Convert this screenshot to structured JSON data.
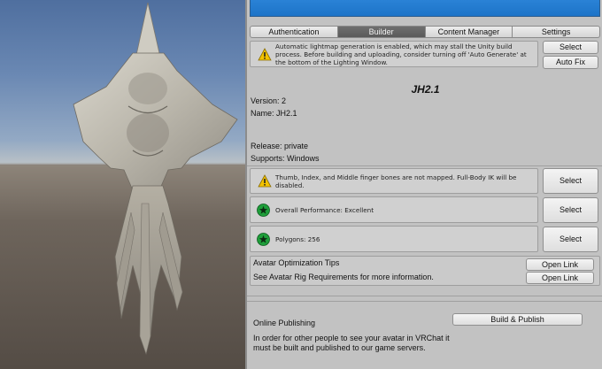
{
  "tabs": [
    {
      "label": "Authentication",
      "active": false
    },
    {
      "label": "Builder",
      "active": true
    },
    {
      "label": "Content Manager",
      "active": false
    },
    {
      "label": "Settings",
      "active": false
    }
  ],
  "lightmap_warning": {
    "icon": "warning-icon",
    "text": "Automatic lightmap generation is enabled, which may stall the Unity build process. Before building and uploading, consider turning off 'Auto Generate' at the bottom of the Lighting Window.",
    "select_label": "Select",
    "autofix_label": "Auto Fix"
  },
  "avatar": {
    "name_title": "JH2.1",
    "version_line": "Version: 2",
    "name_line": "Name: JH2.1",
    "release_line": "Release: private",
    "supports_line": "Supports: Windows"
  },
  "checks": [
    {
      "icon": "warning-icon",
      "text": "Thumb, Index, and Middle finger bones are not mapped. Full-Body IK will be disabled.",
      "button": "Select"
    },
    {
      "icon": "star-check-icon",
      "text": "Overall Performance: Excellent",
      "button": "Select"
    },
    {
      "icon": "star-check-icon",
      "text": "Polygons: 256",
      "button": "Select"
    }
  ],
  "tips": {
    "title": "Avatar Optimization Tips",
    "rig_text": "See Avatar Rig Requirements for more information.",
    "open_link_label": "Open Link"
  },
  "publishing": {
    "label": "Online Publishing",
    "button": "Build & Publish",
    "description": "In order for other people to see your avatar in VRChat it must be built and published to our game servers."
  },
  "colors": {
    "banner": "#1d74c8",
    "active_tab": "#5f5f5f",
    "ok_green": "#1e9e3a",
    "warning_yellow": "#f2c200"
  }
}
